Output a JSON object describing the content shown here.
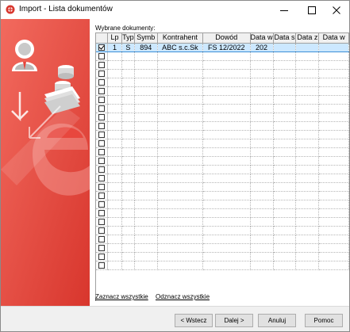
{
  "window": {
    "title": "Import - Lista dokumentów"
  },
  "content": {
    "caption": "Wybrane dokumenty:"
  },
  "table": {
    "columns": [
      "Lp",
      "Typ",
      "Symb",
      "Kontrahent",
      "Dowód",
      "Data w",
      "Data s",
      "Data z",
      "Data w"
    ],
    "rows": [
      {
        "checked": true,
        "cells": [
          "1",
          "S",
          "894",
          "ABC s.c.Sk",
          "FS 12/2022",
          "202",
          "",
          "",
          ""
        ]
      }
    ],
    "empty_row_count": 25
  },
  "links": {
    "select_all": "Zaznacz wszystkie",
    "deselect_all": "Odznacz wszystkie"
  },
  "footer": {
    "back": "< Wstecz",
    "next": "Dalej >",
    "cancel": "Anuluj",
    "help": "Pomoc"
  },
  "colors": {
    "side_panel": "#e8433a",
    "selected_row": "#cce8ff"
  }
}
